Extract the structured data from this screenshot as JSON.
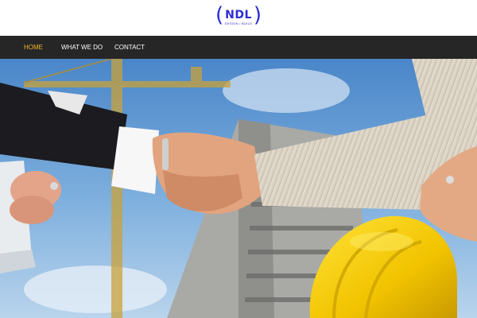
{
  "logo": {
    "text": "NDL",
    "subtitle": "DESIGN / BUILD",
    "color": "#2b2bd6"
  },
  "nav": {
    "items": [
      {
        "label": "HOME",
        "active": true
      },
      {
        "label": "WHAT WE DO",
        "active": false
      },
      {
        "label": "CONTACT",
        "active": false
      }
    ],
    "active_color": "#f0b52a",
    "background": "#262626"
  },
  "hero": {
    "image": "handshake-construction-photo"
  }
}
